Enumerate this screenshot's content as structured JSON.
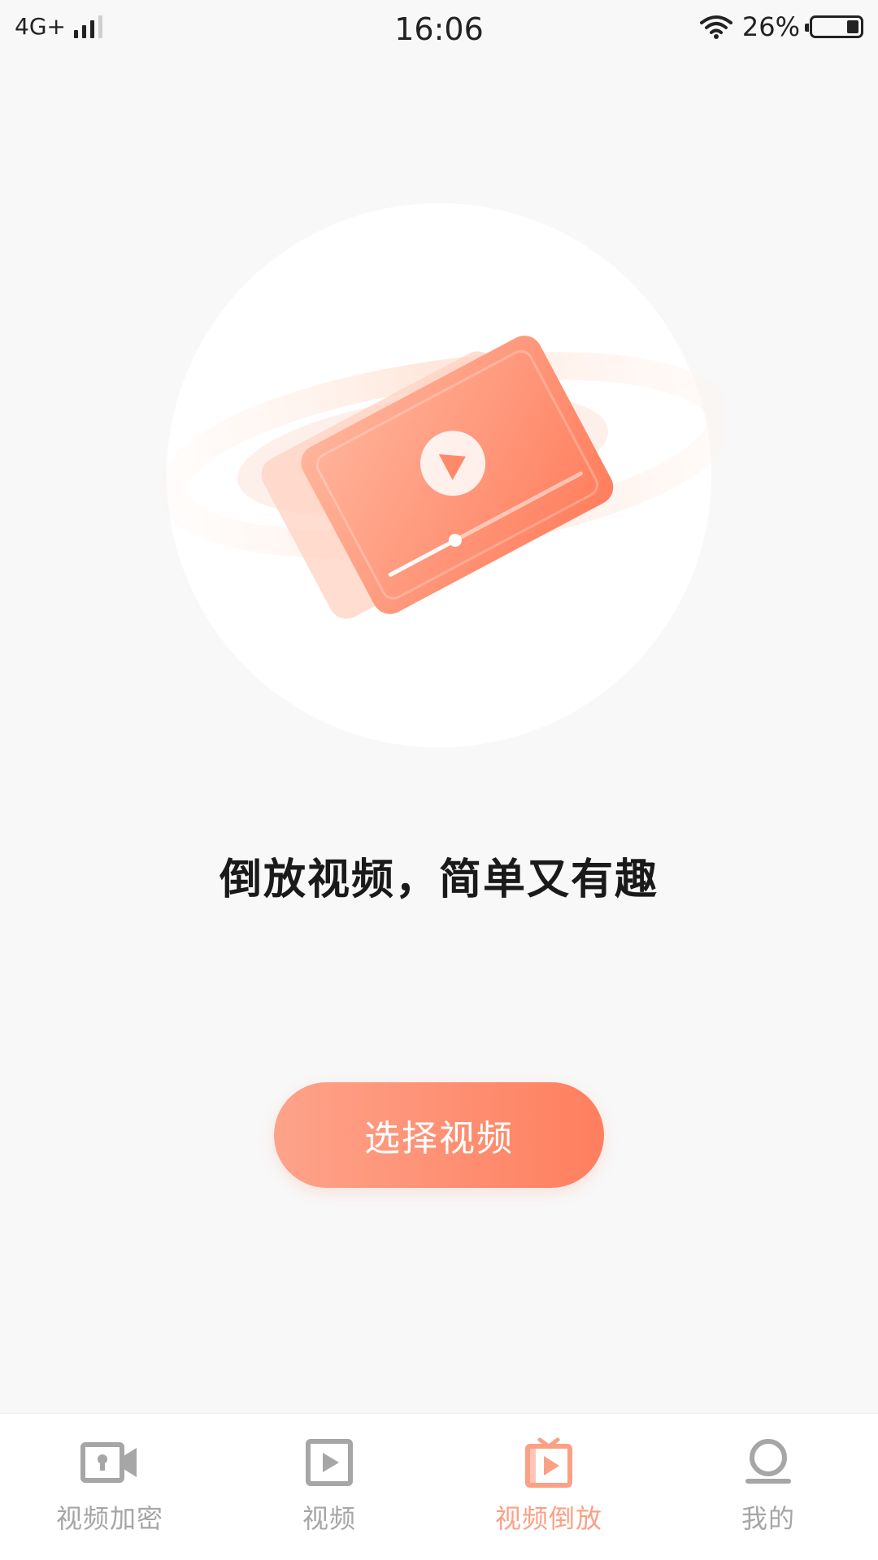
{
  "status_bar": {
    "network": "4G+",
    "time": "16:06",
    "battery": "26%",
    "battery_level": 0.26
  },
  "main": {
    "slogan": "倒放视频，简单又有趣",
    "choose_button_label": "选择视频"
  },
  "bottom_nav": {
    "items": [
      {
        "label": "视频加密",
        "icon": "video-lock-icon"
      },
      {
        "label": "视频",
        "icon": "play-icon"
      },
      {
        "label": "视频倒放",
        "icon": "video-reverse-icon"
      },
      {
        "label": "我的",
        "icon": "profile-icon"
      }
    ],
    "active": "视频倒放"
  },
  "colors": {
    "accent": "#ff8a6a",
    "accent_light": "#fca085",
    "inactive": "#a6a6a6",
    "text_dark": "#1a1a1a",
    "background": "#f8f8f8"
  }
}
